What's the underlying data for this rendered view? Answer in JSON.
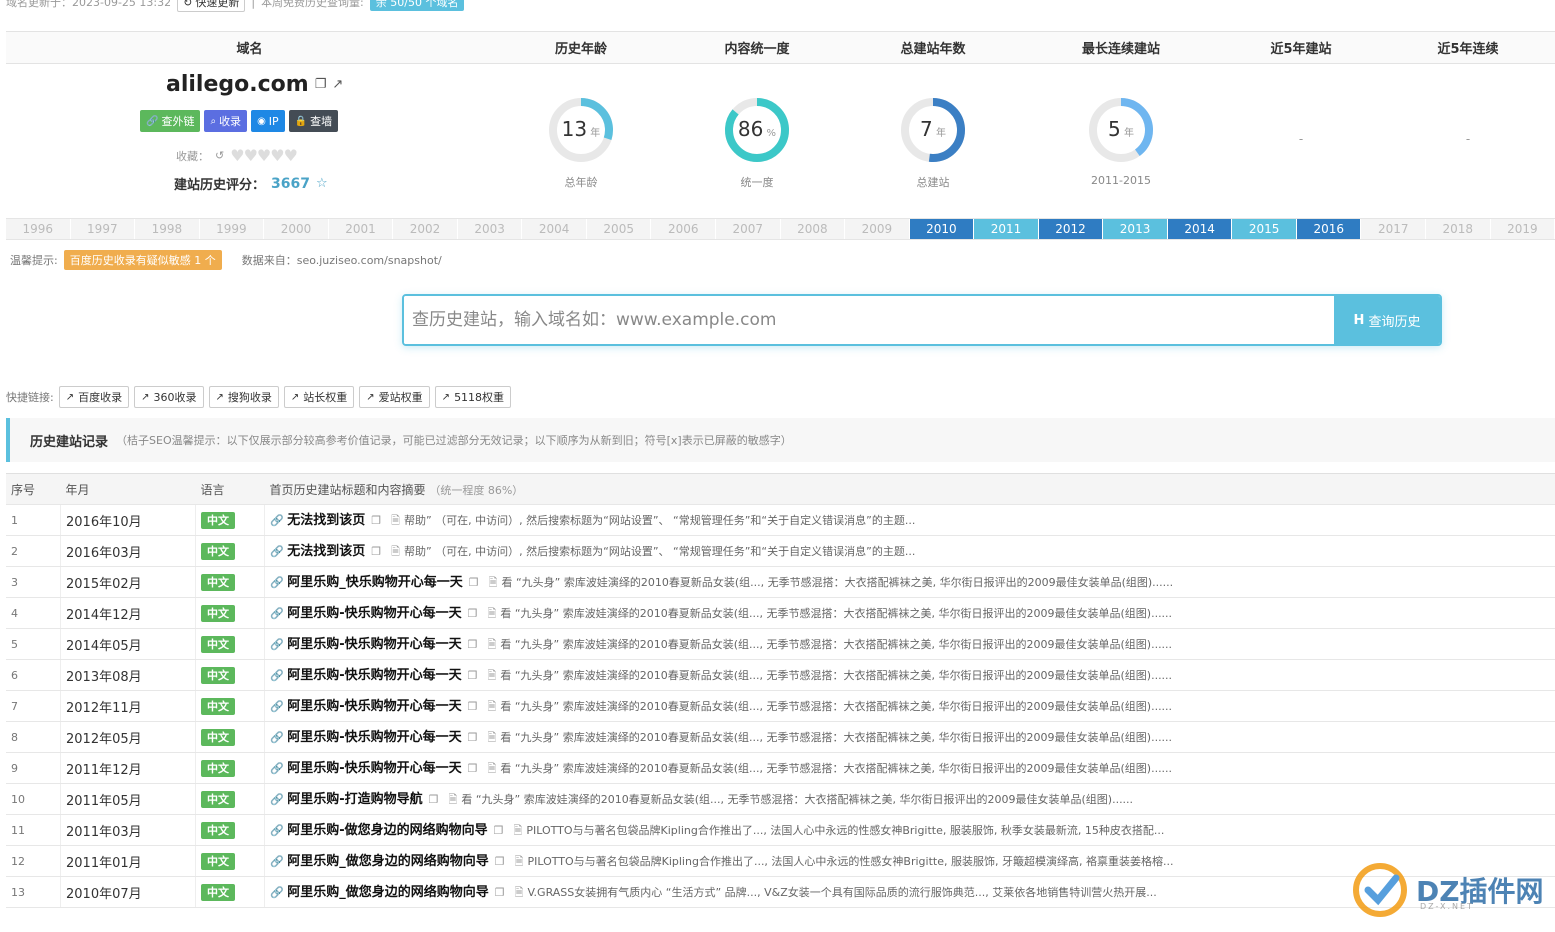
{
  "top": {
    "updated_text": "域名更新于：2023-09-25 13:32",
    "quick_update": "快速更新",
    "weekly_text": "本周免费历史查询量:",
    "quota_badge": "余 50/50 个域名"
  },
  "summary": {
    "headers": [
      "域名",
      "历史年龄",
      "内容统一度",
      "总建站年数",
      "最长连续建站",
      "近5年建站",
      "近5年连续"
    ],
    "domain": "alilego.com",
    "tags": [
      {
        "label": "查外链",
        "color": "#5cb85c",
        "icon": "link-icon"
      },
      {
        "label": "收录",
        "color": "#5b6ee1",
        "icon": "search-icon"
      },
      {
        "label": "IP",
        "color": "#1e88e5",
        "icon": "pin-icon"
      },
      {
        "label": "查墙",
        "color": "#444c55",
        "icon": "lock-icon"
      }
    ],
    "fav_label": "收藏：",
    "score_label": "建站历史评分：",
    "score_value": "3667",
    "gauges": [
      {
        "value": "13",
        "unit": "年",
        "label": "总年龄",
        "fraction": 0.3,
        "color": "#5bc0de"
      },
      {
        "value": "86",
        "unit": "%",
        "label": "统一度",
        "fraction": 0.86,
        "color": "#3cc8c8"
      },
      {
        "value": "7",
        "unit": "年",
        "label": "总建站",
        "fraction": 0.52,
        "color": "#3b7fc4"
      },
      {
        "value": "5",
        "unit": "年",
        "label": "2011-2015",
        "fraction": 0.4,
        "color": "#6fb6f0"
      }
    ],
    "dash_values": [
      "-",
      "-"
    ]
  },
  "years": [
    {
      "y": "1996",
      "on": false
    },
    {
      "y": "1997",
      "on": false
    },
    {
      "y": "1998",
      "on": false
    },
    {
      "y": "1999",
      "on": false
    },
    {
      "y": "2000",
      "on": false
    },
    {
      "y": "2001",
      "on": false
    },
    {
      "y": "2002",
      "on": false
    },
    {
      "y": "2003",
      "on": false
    },
    {
      "y": "2004",
      "on": false
    },
    {
      "y": "2005",
      "on": false
    },
    {
      "y": "2006",
      "on": false
    },
    {
      "y": "2007",
      "on": false
    },
    {
      "y": "2008",
      "on": false
    },
    {
      "y": "2009",
      "on": false
    },
    {
      "y": "2010",
      "on": true,
      "color": "#2f7cc2"
    },
    {
      "y": "2011",
      "on": true,
      "color": "#5bc0de"
    },
    {
      "y": "2012",
      "on": true,
      "color": "#2f7cc2"
    },
    {
      "y": "2013",
      "on": true,
      "color": "#5bc0de"
    },
    {
      "y": "2014",
      "on": true,
      "color": "#2f7cc2"
    },
    {
      "y": "2015",
      "on": true,
      "color": "#5bc0de"
    },
    {
      "y": "2016",
      "on": true,
      "color": "#2f7cc2"
    },
    {
      "y": "2017",
      "on": false
    },
    {
      "y": "2018",
      "on": false
    },
    {
      "y": "2019",
      "on": false
    }
  ],
  "tip": {
    "label": "温馨提示:",
    "badge": "百度历史收录有疑似敏感 1 个",
    "source": "数据来自：seo.juziseo.com/snapshot/"
  },
  "search": {
    "placeholder": "查历史建站，输入域名如：www.example.com",
    "button": "查询历史"
  },
  "quick": {
    "label": "快捷链接:",
    "links": [
      "百度收录",
      "360收录",
      "搜狗收录",
      "站长权重",
      "爱站权重",
      "5118权重"
    ]
  },
  "section": {
    "title": "历史建站记录",
    "note": "（桔子SEO温馨提示：以下仅展示部分较高参考价值记录，可能已过滤部分无效记录；以下顺序为从新到旧；符号[x]表示已屏蔽的敏感字）"
  },
  "table": {
    "headers": [
      "序号",
      "年月",
      "语言",
      "首页历史建站标题和内容摘要"
    ],
    "header_note": "（统一程度 86%）",
    "rows": [
      {
        "idx": "1",
        "date": "2016年10月",
        "lang": "中文",
        "title": "无法找到该页",
        "summary": "帮助” （可在, 中访问）, 然后搜索标题为“网站设置”、 “常规管理任务”和“关于自定义错误消息”的主题..."
      },
      {
        "idx": "2",
        "date": "2016年03月",
        "lang": "中文",
        "title": "无法找到该页",
        "summary": "帮助” （可在, 中访问）, 然后搜索标题为“网站设置”、 “常规管理任务”和“关于自定义错误消息”的主题..."
      },
      {
        "idx": "3",
        "date": "2015年02月",
        "lang": "中文",
        "title": "阿里乐购_快乐购物开心每一天",
        "summary": "看 “九头身” 索库波娃演绎的2010春夏新品女装(组..., 无季节感混搭：大衣搭配裤袜之美, 华尔街日报评出的2009最佳女装单品(组图)......"
      },
      {
        "idx": "4",
        "date": "2014年12月",
        "lang": "中文",
        "title": "阿里乐购-快乐购物开心每一天",
        "summary": "看 “九头身” 索库波娃演绎的2010春夏新品女装(组..., 无季节感混搭：大衣搭配裤袜之美, 华尔街日报评出的2009最佳女装单品(组图)......"
      },
      {
        "idx": "5",
        "date": "2014年05月",
        "lang": "中文",
        "title": "阿里乐购-快乐购物开心每一天",
        "summary": "看 “九头身” 索库波娃演绎的2010春夏新品女装(组..., 无季节感混搭：大衣搭配裤袜之美, 华尔街日报评出的2009最佳女装单品(组图)......"
      },
      {
        "idx": "6",
        "date": "2013年08月",
        "lang": "中文",
        "title": "阿里乐购-快乐购物开心每一天",
        "summary": "看 “九头身” 索库波娃演绎的2010春夏新品女装(组..., 无季节感混搭：大衣搭配裤袜之美, 华尔街日报评出的2009最佳女装单品(组图)......"
      },
      {
        "idx": "7",
        "date": "2012年11月",
        "lang": "中文",
        "title": "阿里乐购-快乐购物开心每一天",
        "summary": "看 “九头身” 索库波娃演绎的2010春夏新品女装(组..., 无季节感混搭：大衣搭配裤袜之美, 华尔街日报评出的2009最佳女装单品(组图)......"
      },
      {
        "idx": "8",
        "date": "2012年05月",
        "lang": "中文",
        "title": "阿里乐购-快乐购物开心每一天",
        "summary": "看 “九头身” 索库波娃演绎的2010春夏新品女装(组..., 无季节感混搭：大衣搭配裤袜之美, 华尔街日报评出的2009最佳女装单品(组图)......"
      },
      {
        "idx": "9",
        "date": "2011年12月",
        "lang": "中文",
        "title": "阿里乐购-快乐购物开心每一天",
        "summary": "看 “九头身” 索库波娃演绎的2010春夏新品女装(组..., 无季节感混搭：大衣搭配裤袜之美, 华尔街日报评出的2009最佳女装单品(组图)......"
      },
      {
        "idx": "10",
        "date": "2011年05月",
        "lang": "中文",
        "title": "阿里乐购-打造购物导航",
        "summary": "看 “九头身” 索库波娃演绎的2010春夏新品女装(组..., 无季节感混搭：大衣搭配裤袜之美, 华尔街日报评出的2009最佳女装单品(组图)......"
      },
      {
        "idx": "11",
        "date": "2011年03月",
        "lang": "中文",
        "title": "阿里乐购-做您身边的网络购物向导",
        "summary": "PILOTTO与与著名包袋品牌Kipling合作推出了..., 法国人心中永远的性感女神Brigitte, 服装服饰, 秋季女装最新流, 15种皮衣搭配..."
      },
      {
        "idx": "12",
        "date": "2011年01月",
        "lang": "中文",
        "title": "阿里乐购_做您身边的网络购物向导",
        "summary": "PILOTTO与与著名包袋品牌Kipling合作推出了..., 法国人心中永远的性感女神Brigitte, 服装服饰, 牙簸超模演绎高, 袼禀重装姜格榕..."
      },
      {
        "idx": "13",
        "date": "2010年07月",
        "lang": "中文",
        "title": "阿里乐购_做您身边的网络购物向导",
        "summary": "V.GRASS女装拥有气质内心 “生活方式” 品牌..., V&Z女装一个具有国际品质的流行服饰典范..., 艾莱依各地销售特训营火热开展..."
      }
    ]
  },
  "watermark": {
    "text": "DZ插件网",
    "sub": "DZ-X.NET"
  }
}
